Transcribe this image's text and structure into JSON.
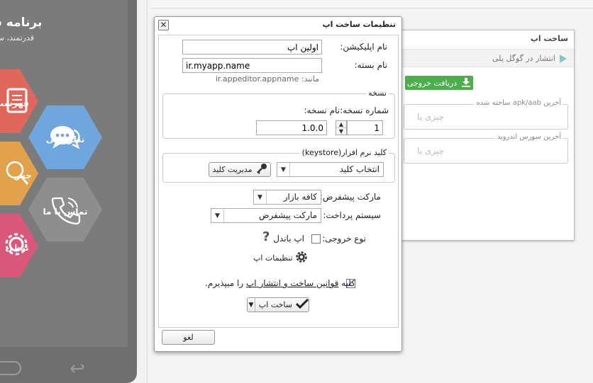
{
  "phone": {
    "title": "برنامه ساز",
    "subtitle": "قدرتمند، س",
    "tiles": [
      {
        "label": "نظر دهی",
        "icon": "chat-bubbles-icon",
        "color": "#6ea6dd"
      },
      {
        "label": "تماس با ما",
        "icon": "phone-icon",
        "color": "#8e8e8e"
      },
      {
        "label": "فهرست",
        "icon": "document-icon",
        "color": "#e0675c"
      },
      {
        "label": "جس",
        "icon": "search-icon",
        "color": "#e2a24d"
      },
      {
        "label": "تنظی",
        "icon": "gear-icon",
        "color": "#d9577a"
      }
    ]
  },
  "build_panel": {
    "title": "ساخت اپ",
    "publish_label": "انتشار در گوگل پلی",
    "download_label": "دریافت خروجی",
    "apk_legend": "آخرین apk/aab ساخته شده",
    "apk_empty": "چیزی یا",
    "source_legend": "آخرین سورس اندروید",
    "source_empty": "چیزی یا"
  },
  "dialog": {
    "title": "تنظیمات ساخت اپ",
    "close_symbol": "✕",
    "app_name_label": "نام اپلیکیشن:",
    "app_name_value": "اولین اپ",
    "package_label": "نام بسته:",
    "package_value": "ir.myapp.name",
    "package_hint": "مانند: ir.appeditor.appname",
    "version_group": "نسخه",
    "version_number_label": "شماره نسخه:",
    "version_number_value": "1",
    "version_name_label": "نام نسخه:",
    "version_name_value": "1.0.0",
    "keystore_group": "کلید نرم افزار(keystore)",
    "keystore_select": "انتخاب کلید",
    "manage_key_label": "مدیریت کلید",
    "market_label": "مارکت پیشفرض:",
    "market_value": "کافه بازار",
    "payment_label": "سیستم پرداخت:",
    "payment_value": "مارکت پیشفرض",
    "output_type_label": "نوع خروجی:",
    "bundle_label": "اپ باندل",
    "bundle_checked": false,
    "help_symbol": "?",
    "app_settings_label": "تنظیمات اپ",
    "terms_prefix": "کلیه",
    "terms_link": "قوانین ساخت و انتشار اپ",
    "terms_suffix": "را میپذیرم.",
    "terms_checked": true,
    "build_label": "ساخت اپ",
    "cancel_label": "لغو"
  }
}
